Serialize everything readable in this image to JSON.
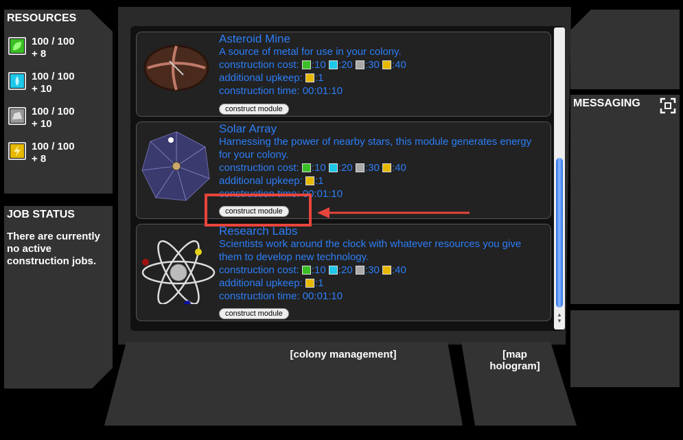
{
  "resources": {
    "title": "RESOURCES",
    "items": [
      {
        "icon": "leaf-icon",
        "color": "#3bbf26",
        "amount": "100 / 100",
        "rate": "+ 8"
      },
      {
        "icon": "water-drop-icon",
        "color": "#1fc7e8",
        "amount": "100 / 100",
        "rate": "+ 10"
      },
      {
        "icon": "metal-icon",
        "color": "#aaaaaa",
        "amount": "100 / 100",
        "rate": "+ 10"
      },
      {
        "icon": "lightning-icon",
        "color": "#e6b800",
        "amount": "100 / 100",
        "rate": "+ 8"
      }
    ]
  },
  "job_status": {
    "title": "JOB STATUS",
    "message": "There are currently no active construction jobs."
  },
  "messaging": {
    "title": "MESSAGING"
  },
  "modules": [
    {
      "name": "Asteroid Mine",
      "description": "A source of metal for use in your colony.",
      "cost_label": "construction cost:",
      "costs": [
        ":10",
        ":20",
        ":30",
        ":40"
      ],
      "upkeep_label": "additional upkeep:",
      "upkeep": ":1",
      "time_label": "construction time:",
      "time": "00:01:10",
      "button": "construct module"
    },
    {
      "name": "Solar Array",
      "description": "Harnessing the power of nearby stars, this module generates energy for your colony.",
      "cost_label": "construction cost:",
      "costs": [
        ":10",
        ":20",
        ":30",
        ":40"
      ],
      "upkeep_label": "additional upkeep:",
      "upkeep": ":1",
      "time_label": "construction time:",
      "time": "00:01:10",
      "button": "construct module"
    },
    {
      "name": "Research Labs",
      "description": "Scientists work around the clock with whatever resources you give them to develop new technology.",
      "cost_label": "construction cost:",
      "costs": [
        ":10",
        ":20",
        ":30",
        ":40"
      ],
      "upkeep_label": "additional upkeep:",
      "upkeep": ":1",
      "time_label": "construction time:",
      "time": "00:01:10",
      "button": "construct module"
    }
  ],
  "nav": {
    "colony": "[colony management]",
    "map": "[map hologram]"
  },
  "colors": {
    "accent": "#2d7ef7",
    "highlight": "#e8453c"
  }
}
